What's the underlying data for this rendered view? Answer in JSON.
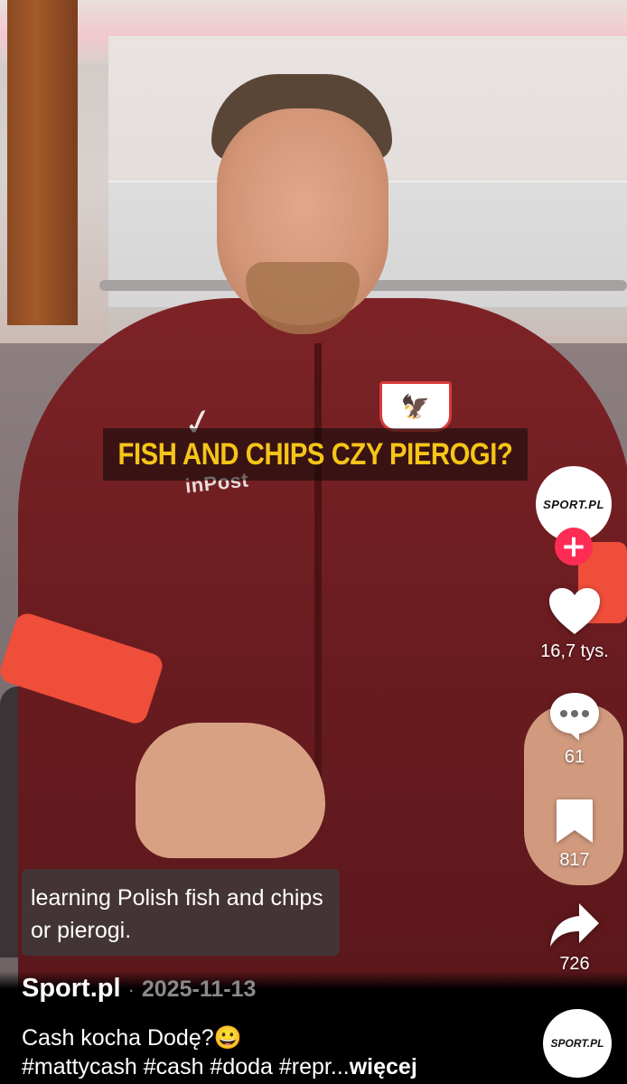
{
  "video": {
    "overlay_question": "FISH AND CHIPS CZY PIEROGI?",
    "subtitle_text": "learning Polish fish and chips or pierogi.",
    "sponsor_text": "inPost"
  },
  "creator": {
    "avatar_text": "SPORT.PL",
    "follow_symbol": "+"
  },
  "actions": {
    "likes": "16,7 tys.",
    "comments": "61",
    "bookmarks": "817",
    "shares": "726"
  },
  "post": {
    "author": "Sport.pl",
    "separator": "·",
    "date": "2025-11-13",
    "caption_line1": "Cash kocha Dodę?😀",
    "caption_line2": "#mattycash #cash #doda #repr...",
    "more_label": "więcej"
  },
  "colors": {
    "accent": "#fe2c55",
    "overlay_text": "#f5c518",
    "date_text": "#8a8a8a"
  },
  "icons": {
    "like": "heart-icon",
    "comment": "comment-bubble-icon",
    "bookmark": "bookmark-icon",
    "share": "share-arrow-icon",
    "follow": "plus-icon"
  }
}
